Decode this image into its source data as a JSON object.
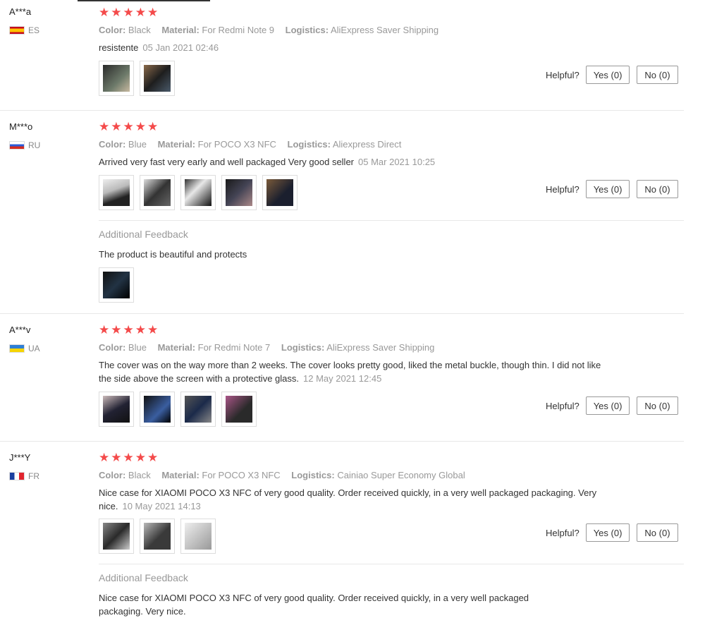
{
  "helpful_label": "Helpful?",
  "reviews": [
    {
      "user": "A***a",
      "country": "ES",
      "stars": "★★★★★",
      "attrs": [
        {
          "label": "Color:",
          "value": "Black"
        },
        {
          "label": "Material:",
          "value": "For Redmi Note 9"
        },
        {
          "label": "Logistics:",
          "value": "AliExpress Saver Shipping"
        }
      ],
      "text": "resistente",
      "date": "05 Jan 2021 02:46",
      "yes": "Yes (0)",
      "no": "No (0)"
    },
    {
      "user": "M***o",
      "country": "RU",
      "stars": "★★★★★",
      "attrs": [
        {
          "label": "Color:",
          "value": "Blue"
        },
        {
          "label": "Material:",
          "value": "For POCO X3 NFC"
        },
        {
          "label": "Logistics:",
          "value": "Aliexpress Direct"
        }
      ],
      "text": "Arrived very fast very early and well packaged Very good seller",
      "date": "05 Mar 2021 10:25",
      "yes": "Yes (0)",
      "no": "No (0)",
      "feedback_title": "Additional Feedback",
      "feedback_text": "The product is beautiful and protects"
    },
    {
      "user": "A***v",
      "country": "UA",
      "stars": "★★★★★",
      "attrs": [
        {
          "label": "Color:",
          "value": "Blue"
        },
        {
          "label": "Material:",
          "value": "For Redmi Note 7"
        },
        {
          "label": "Logistics:",
          "value": "AliExpress Saver Shipping"
        }
      ],
      "text": "The cover was on the way more than 2 weeks. The cover looks pretty good, liked the metal buckle, though thin. I did not like the side above the screen with a protective glass.",
      "date": "12 May 2021 12:45",
      "yes": "Yes (0)",
      "no": "No (0)"
    },
    {
      "user": "J***Y",
      "country": "FR",
      "stars": "★★★★★",
      "attrs": [
        {
          "label": "Color:",
          "value": "Black"
        },
        {
          "label": "Material:",
          "value": "For POCO X3 NFC"
        },
        {
          "label": "Logistics:",
          "value": "Cainiao Super Economy Global"
        }
      ],
      "text": "Nice case for XIAOMI POCO X3 NFC of very good quality. Order received quickly, in a very well packaged packaging. Very nice.",
      "date": "10 May 2021 14:13",
      "yes": "Yes (0)",
      "no": "No (0)",
      "feedback_title": "Additional Feedback",
      "feedback_text": "Nice case for XIAOMI POCO X3 NFC of very good quality. Order received quickly, in a very well packaged packaging. Very nice."
    }
  ],
  "colors": {
    "star": "#f44a4a",
    "muted": "#999999",
    "border": "#e8e8e8"
  }
}
